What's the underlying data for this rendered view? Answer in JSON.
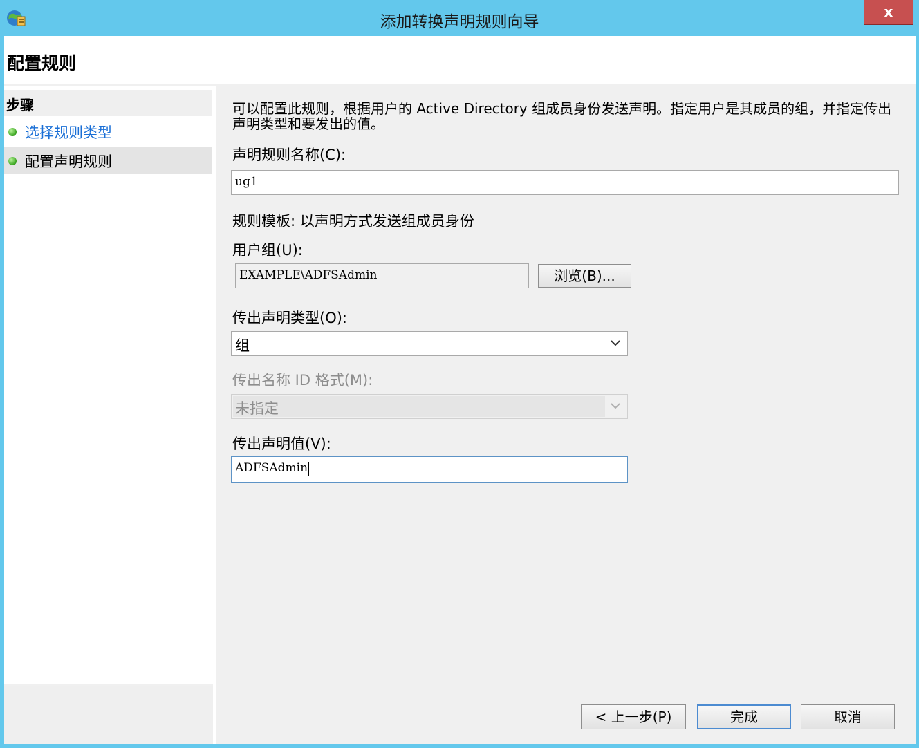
{
  "window": {
    "title": "添加转换声明规则向导",
    "close_label": "x"
  },
  "header": {
    "title": "配置规则"
  },
  "steps": {
    "heading": "步骤",
    "items": [
      {
        "label": "选择规则类型"
      },
      {
        "label": "配置声明规则"
      }
    ]
  },
  "form": {
    "description": "可以配置此规则，根据用户的 Active Directory 组成员身份发送声明。指定用户是其成员的组，并指定传出声明类型和要发出的值。",
    "rule_name_label": "声明规则名称(C):",
    "rule_name_value": "ug1",
    "template_text": "规则模板: 以声明方式发送组成员身份",
    "user_group_label": "用户组(U):",
    "user_group_value": "EXAMPLE\\ADFSAdmin",
    "browse_label": "浏览(B)...",
    "claim_type_label": "传出声明类型(O):",
    "claim_type_value": "组",
    "name_id_format_label": "传出名称 ID 格式(M):",
    "name_id_format_value": "未指定",
    "claim_value_label": "传出声明值(V):",
    "claim_value_value": "ADFSAdmin"
  },
  "buttons": {
    "back_label": "< 上一步(P)",
    "finish_label": "完成",
    "cancel_label": "取消"
  },
  "colors": {
    "titlebar": "#63c8ec",
    "close": "#c75050",
    "link": "#1a6fd6",
    "step_dot": "#3ea824"
  }
}
